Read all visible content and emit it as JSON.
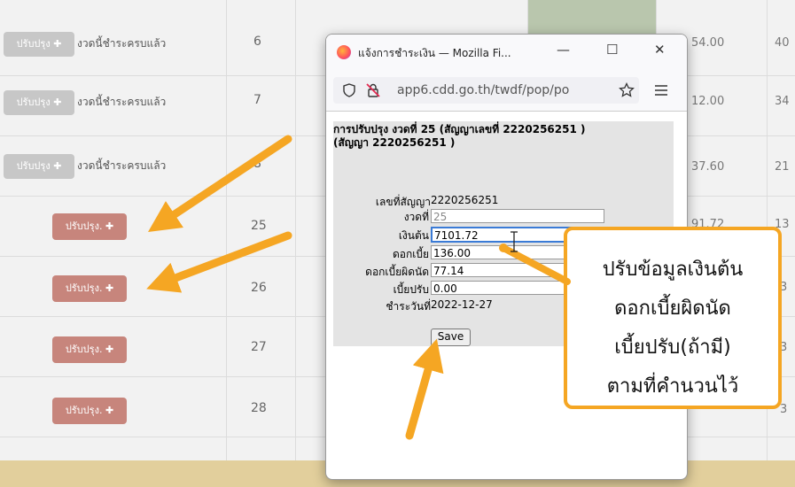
{
  "table": {
    "rows": [
      {
        "button": "ปรับปรุง ✚",
        "status": "งวดนี้ชำระครบแล้ว",
        "installment": "6",
        "amount": "54.00",
        "right": "40"
      },
      {
        "button": "ปรับปรุง ✚",
        "status": "งวดนี้ชำระครบแล้ว",
        "installment": "7",
        "amount": "12.00",
        "right": "34"
      },
      {
        "button": "ปรับปรุง ✚",
        "status": "งวดนี้ชำระครบแล้ว",
        "installment": "8",
        "amount": "37.60",
        "right": "21"
      },
      {
        "button": "ปรับปรุง. ✚",
        "status": "",
        "installment": "25",
        "amount": "91.72",
        "right": "13"
      },
      {
        "button": "ปรับปรุง. ✚",
        "status": "",
        "installment": "26",
        "amount": "",
        "right": "3"
      },
      {
        "button": "ปรับปรุง. ✚",
        "status": "",
        "installment": "27",
        "amount": "",
        "right": "3"
      },
      {
        "button": "ปรับปรุง. ✚",
        "status": "",
        "installment": "28",
        "amount": "",
        "right": "3"
      }
    ]
  },
  "popup": {
    "window_title": "แจ้งการชำระเงิน — Mozilla Fi...",
    "minimize": "—",
    "maximize": "☐",
    "close": "✕",
    "url": "app6.cdd.go.th/twdf/pop/po",
    "heading_line1": "การปรับปรุง งวดที่ 25 (สัญญาเลขที่ 2220256251 )",
    "heading_line2": "(สัญญา 2220256251 )",
    "contract_label": "เลขที่สัญญา",
    "contract_value": "2220256251",
    "installment_label": "งวดที่",
    "installment_value": "25",
    "principal_label": "เงินต้น",
    "principal_value": "7101.72",
    "interest_label": "ดอกเบี้ย",
    "interest_value": "136.00",
    "default_interest_label": "ดอกเบี้ยผิดนัด",
    "default_interest_value": "77.14",
    "fine_label": "เบี้ยปรับ",
    "fine_value": "0.00",
    "paid_date_label": "ชำระวันที่",
    "paid_date_value": "2022-12-27",
    "save_label": "Save"
  },
  "callout": {
    "line1": "ปรับข้อมูลเงินต้น",
    "line2": "ดอกเบี้ยผิดนัด",
    "line3": "เบี้ยปรับ(ถ้ามี)",
    "line4": "ตามที่คำนวนไว้"
  },
  "colors": {
    "arrow": "#f5a623",
    "grey_button": "#c7c7c7",
    "red_button": "#c7857c",
    "popup_active_border": "#3b7bd6"
  }
}
